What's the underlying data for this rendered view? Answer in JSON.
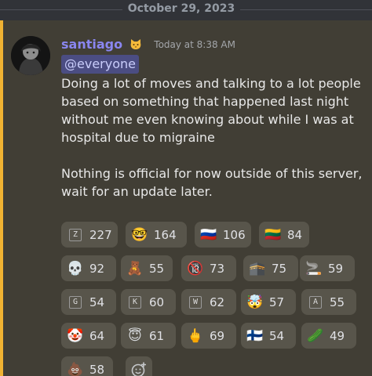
{
  "divider": {
    "date": "October 29, 2023"
  },
  "message": {
    "author": "santiago",
    "author_badge_icon": "cat-face-icon",
    "timestamp": "Today at 8:38 AM",
    "mention": "@everyone",
    "body": "Doing a lot of moves and talking to a lot people based on something that happened last night without me even knowing about while I was at hospital due to migraine\n\nNothing is official for now outside of this server, wait for an update later."
  },
  "colors": {
    "username": "#8a86f0",
    "mention_highlight": "#f0b232",
    "mention_pill_bg": "#4b4d82"
  },
  "reactions": [
    {
      "icon": "letter-z-icon",
      "emoji": "Z",
      "count": "227"
    },
    {
      "icon": "nerd-face-icon",
      "emoji": "🤓",
      "count": "164"
    },
    {
      "icon": "russia-flag-icon",
      "emoji": "🇷🇺",
      "count": "106"
    },
    {
      "icon": "lithuania-flag-icon",
      "emoji": "🇱🇹",
      "count": "84"
    },
    {
      "icon": "skull-icon",
      "emoji": "💀",
      "count": "92"
    },
    {
      "icon": "teddy-bear-icon",
      "emoji": "🧸",
      "count": "55"
    },
    {
      "icon": "no-one-under-eighteen-icon",
      "emoji": "🔞",
      "count": "73"
    },
    {
      "icon": "kaaba-icon",
      "emoji": "🕋",
      "count": "75"
    },
    {
      "icon": "cigarette-icon",
      "emoji": "🚬",
      "count": "59"
    },
    {
      "icon": "letter-g-icon",
      "emoji": "G",
      "count": "54"
    },
    {
      "icon": "letter-k-icon",
      "emoji": "K",
      "count": "60"
    },
    {
      "icon": "letter-w-icon",
      "emoji": "W",
      "count": "62"
    },
    {
      "icon": "exploding-head-icon",
      "emoji": "🤯",
      "count": "57"
    },
    {
      "icon": "letter-a-icon",
      "emoji": "A",
      "count": "55"
    },
    {
      "icon": "clown-face-icon",
      "emoji": "🤡",
      "count": "64"
    },
    {
      "icon": "smiling-face-with-halo-icon",
      "emoji": "😇",
      "count": "61"
    },
    {
      "icon": "middle-finger-icon",
      "emoji": "🖕",
      "count": "69"
    },
    {
      "icon": "finland-flag-icon",
      "emoji": "🇫🇮",
      "count": "54"
    },
    {
      "icon": "cucumber-icon",
      "emoji": "🥒",
      "count": "49"
    },
    {
      "icon": "pile-of-poo-icon",
      "emoji": "💩",
      "count": "58"
    }
  ]
}
